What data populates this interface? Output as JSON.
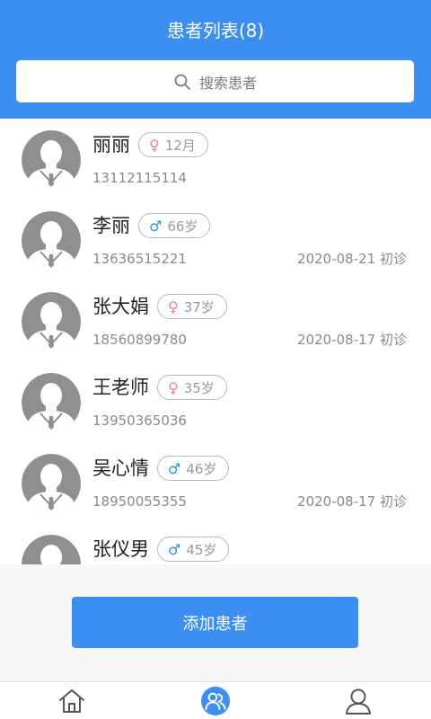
{
  "header": {
    "title": "患者列表(8)"
  },
  "search": {
    "placeholder": "搜索患者"
  },
  "patients": [
    {
      "name": "丽丽",
      "gender": "female",
      "gender_symbol": "♀",
      "age": "12月",
      "phone": "13112115114",
      "visit": ""
    },
    {
      "name": "李丽",
      "gender": "male",
      "gender_symbol": "♂",
      "age": "66岁",
      "phone": "13636515221",
      "visit": "2020-08-21 初诊"
    },
    {
      "name": "张大娟",
      "gender": "female",
      "gender_symbol": "♀",
      "age": "37岁",
      "phone": "18560899780",
      "visit": "2020-08-17 初诊"
    },
    {
      "name": "王老师",
      "gender": "female",
      "gender_symbol": "♀",
      "age": "35岁",
      "phone": "13950365036",
      "visit": ""
    },
    {
      "name": "吴心情",
      "gender": "male",
      "gender_symbol": "♂",
      "age": "46岁",
      "phone": "18950055355",
      "visit": "2020-08-17 初诊"
    },
    {
      "name": "张仪男",
      "gender": "male",
      "gender_symbol": "♂",
      "age": "45岁",
      "phone": "",
      "visit": ""
    }
  ],
  "actions": {
    "add_label": "添加患者"
  },
  "tabbar": {
    "items": [
      {
        "icon": "home-icon",
        "active": false
      },
      {
        "icon": "patients-icon",
        "active": true
      },
      {
        "icon": "profile-icon",
        "active": false
      }
    ]
  },
  "colors": {
    "primary": "#3d8ef1",
    "female": "#f07da2",
    "male": "#2f93df",
    "muted_text": "#8a8a8a"
  }
}
